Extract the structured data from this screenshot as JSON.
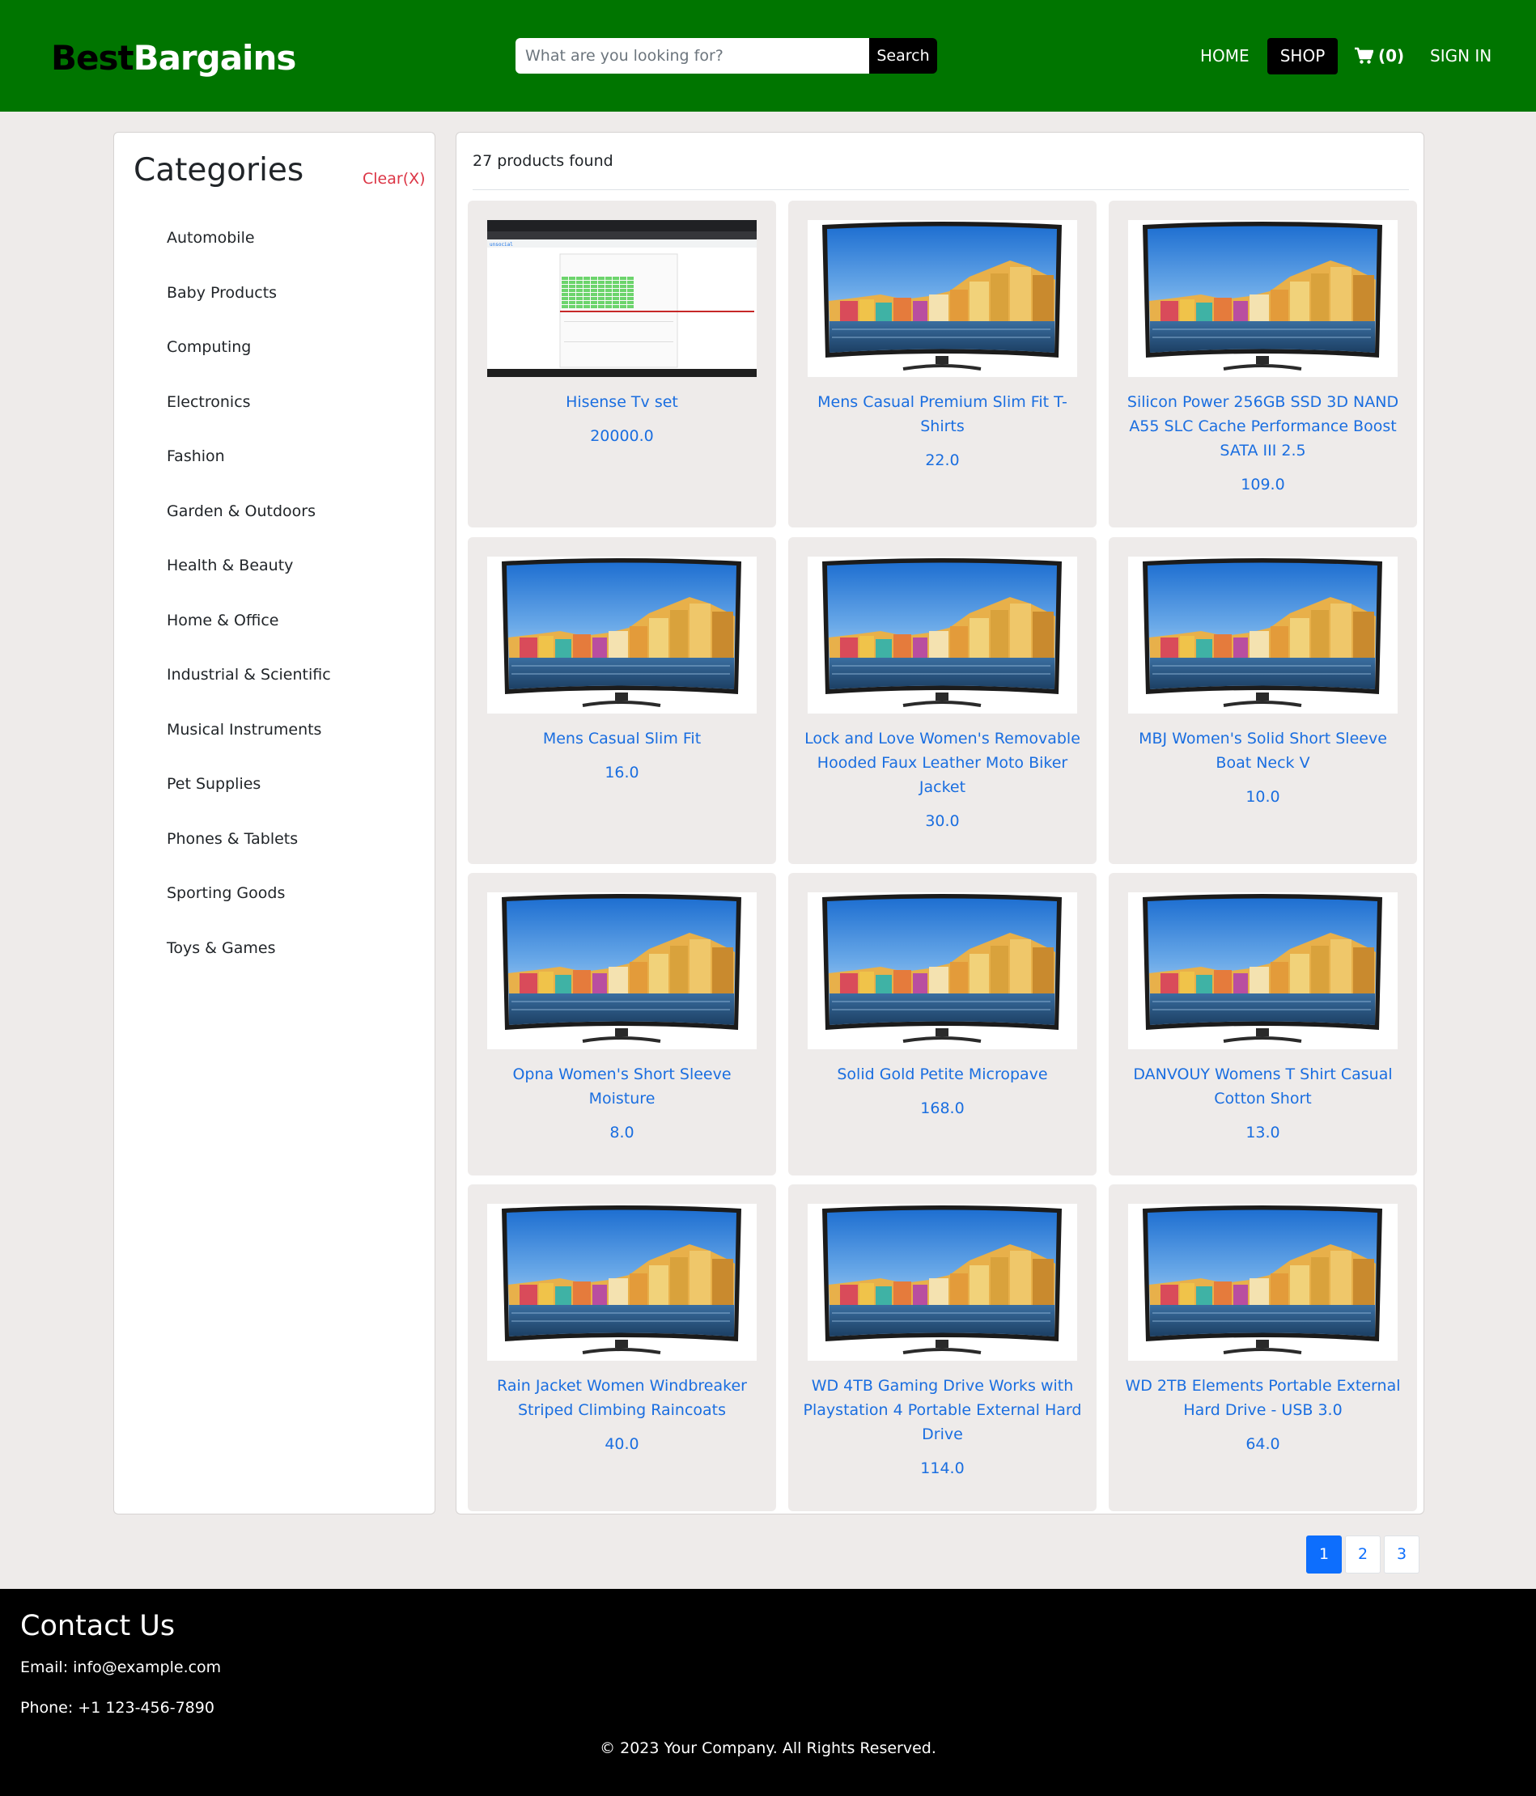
{
  "header": {
    "logo_part1": "Best",
    "logo_part2": "Bargains",
    "search_placeholder": "What are you looking for?",
    "search_button": "Search",
    "nav": {
      "home": "HOME",
      "shop": "SHOP",
      "cart_count": "(0)",
      "sign_in": "SIGN IN"
    },
    "brand_green": "#007500"
  },
  "sidebar": {
    "title": "Categories",
    "clear_label": "Clear(X)",
    "categories": [
      "Automobile",
      "Baby Products",
      "Computing",
      "Electronics",
      "Fashion",
      "Garden & Outdoors",
      "Health & Beauty",
      "Home & Office",
      "Industrial & Scientific",
      "Musical Instruments",
      "Pet Supplies",
      "Phones & Tablets",
      "Sporting Goods",
      "Toys & Games"
    ]
  },
  "main": {
    "products_found": "27 products found",
    "products": [
      {
        "name": "Hisense Tv set",
        "price": "20000.0",
        "image": "screenshot"
      },
      {
        "name": "Mens Casual Premium Slim Fit T-Shirts",
        "price": "22.0",
        "image": "tv"
      },
      {
        "name": "Silicon Power 256GB SSD 3D NAND A55 SLC Cache Performance Boost SATA III 2.5",
        "price": "109.0",
        "image": "tv"
      },
      {
        "name": "Mens Casual Slim Fit",
        "price": "16.0",
        "image": "tv"
      },
      {
        "name": "Lock and Love Women's Removable Hooded Faux Leather Moto Biker Jacket",
        "price": "30.0",
        "image": "tv"
      },
      {
        "name": "MBJ Women's Solid Short Sleeve Boat Neck V",
        "price": "10.0",
        "image": "tv"
      },
      {
        "name": "Opna Women's Short Sleeve Moisture",
        "price": "8.0",
        "image": "tv"
      },
      {
        "name": "Solid Gold Petite Micropave",
        "price": "168.0",
        "image": "tv"
      },
      {
        "name": "DANVOUY Womens T Shirt Casual Cotton Short",
        "price": "13.0",
        "image": "tv"
      },
      {
        "name": "Rain Jacket Women Windbreaker Striped Climbing Raincoats",
        "price": "40.0",
        "image": "tv"
      },
      {
        "name": "WD 4TB Gaming Drive Works with Playstation 4 Portable External Hard Drive",
        "price": "114.0",
        "image": "tv"
      },
      {
        "name": "WD 2TB Elements Portable External Hard Drive - USB 3.0",
        "price": "64.0",
        "image": "tv"
      }
    ]
  },
  "pagination": {
    "pages": [
      "1",
      "2",
      "3"
    ],
    "active": "1"
  },
  "footer": {
    "title": "Contact Us",
    "email": "Email: info@example.com",
    "phone": "Phone: +1 123-456-7890",
    "copyright": "© 2023 Your Company. All Rights Reserved."
  }
}
